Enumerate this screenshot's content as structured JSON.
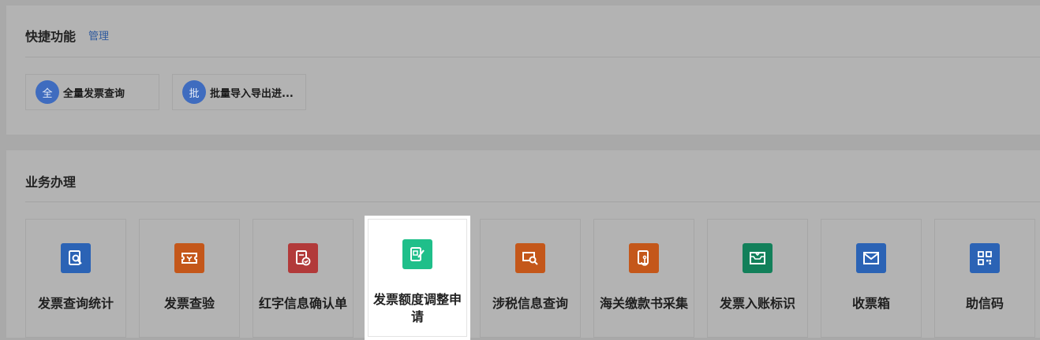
{
  "quick": {
    "title": "快捷功能",
    "manage": "管理",
    "items": [
      {
        "badge": "全",
        "label": "全量发票查询"
      },
      {
        "badge": "批",
        "label": "批量导入导出进..."
      }
    ]
  },
  "business": {
    "title": "业务办理",
    "tiles": [
      {
        "label": "发票查询统计",
        "icon": "invoice-search-icon",
        "color": "#2b63b5"
      },
      {
        "label": "发票查验",
        "icon": "ticket-verify-icon",
        "color": "#c4571a"
      },
      {
        "label": "红字信息确认单",
        "icon": "red-document-check-icon",
        "color": "#b23a3a"
      },
      {
        "label": "发票额度调整申请",
        "icon": "edit-document-icon",
        "color": "#1fbf8a"
      },
      {
        "label": "涉税信息查询",
        "icon": "folder-search-icon",
        "color": "#c4571a"
      },
      {
        "label": "海关缴款书采集",
        "icon": "anchor-document-icon",
        "color": "#c4571a"
      },
      {
        "label": "发票入账标识",
        "icon": "inbox-download-icon",
        "color": "#12805a"
      },
      {
        "label": "收票箱",
        "icon": "envelope-icon",
        "color": "#2b63b5"
      },
      {
        "label": "助信码",
        "icon": "qr-code-icon",
        "color": "#2b63b5"
      }
    ]
  }
}
